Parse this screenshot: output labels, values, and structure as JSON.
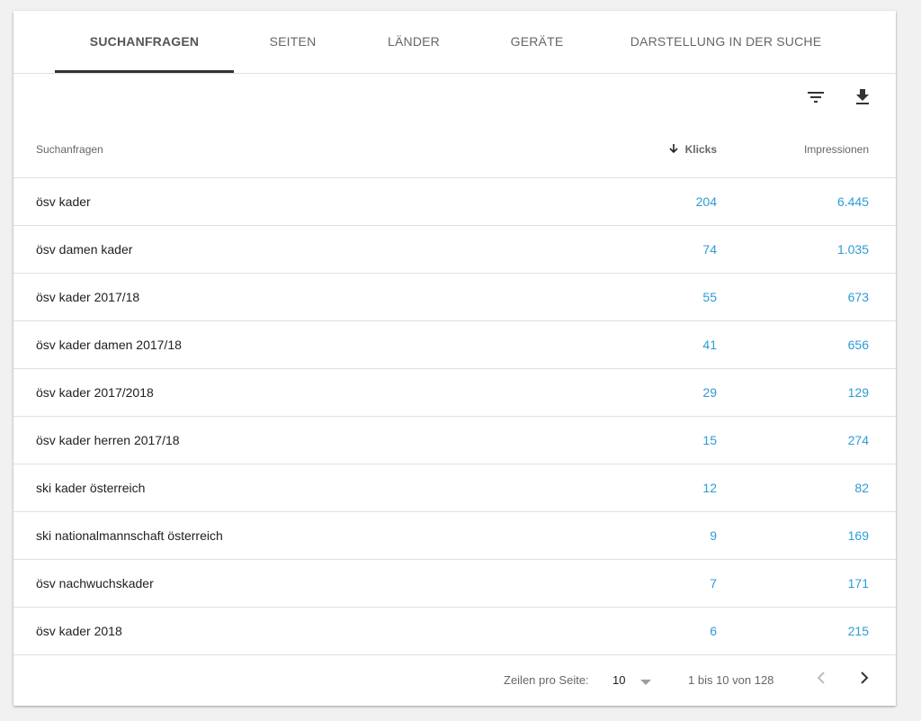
{
  "tabs": [
    {
      "label": "SUCHANFRAGEN",
      "active": true
    },
    {
      "label": "SEITEN",
      "active": false
    },
    {
      "label": "LÄNDER",
      "active": false
    },
    {
      "label": "GERÄTE",
      "active": false
    },
    {
      "label": "DARSTELLUNG IN DER SUCHE",
      "active": false
    }
  ],
  "toolbar": {
    "filter_icon": "filter-icon",
    "download_icon": "download-icon"
  },
  "table": {
    "headers": {
      "query": "Suchanfragen",
      "clicks": "Klicks",
      "impressions": "Impressionen"
    },
    "sort": {
      "column": "clicks",
      "direction": "descending",
      "icon": "arrow-down-icon"
    },
    "rows": [
      {
        "query": "ösv kader",
        "clicks": "204",
        "impressions": "6.445"
      },
      {
        "query": "ösv damen kader",
        "clicks": "74",
        "impressions": "1.035"
      },
      {
        "query": "ösv kader 2017/18",
        "clicks": "55",
        "impressions": "673"
      },
      {
        "query": "ösv kader damen 2017/18",
        "clicks": "41",
        "impressions": "656"
      },
      {
        "query": "ösv kader 2017/2018",
        "clicks": "29",
        "impressions": "129"
      },
      {
        "query": "ösv kader herren 2017/18",
        "clicks": "15",
        "impressions": "274"
      },
      {
        "query": "ski kader österreich",
        "clicks": "12",
        "impressions": "82"
      },
      {
        "query": "ski nationalmannschaft österreich",
        "clicks": "9",
        "impressions": "169"
      },
      {
        "query": "ösv nachwuchskader",
        "clicks": "7",
        "impressions": "171"
      },
      {
        "query": "ösv kader 2018",
        "clicks": "6",
        "impressions": "215"
      }
    ]
  },
  "pagination": {
    "rows_per_page_label": "Zeilen pro Seite:",
    "rows_per_page": "10",
    "range": "1 bis 10 von 128",
    "prev_icon": "chevron-left-icon",
    "next_icon": "chevron-right-icon"
  },
  "colors": {
    "link": "#2e9bd6",
    "active_tab_underline": "#333333",
    "disabled_icon": "#bdbdbd"
  }
}
